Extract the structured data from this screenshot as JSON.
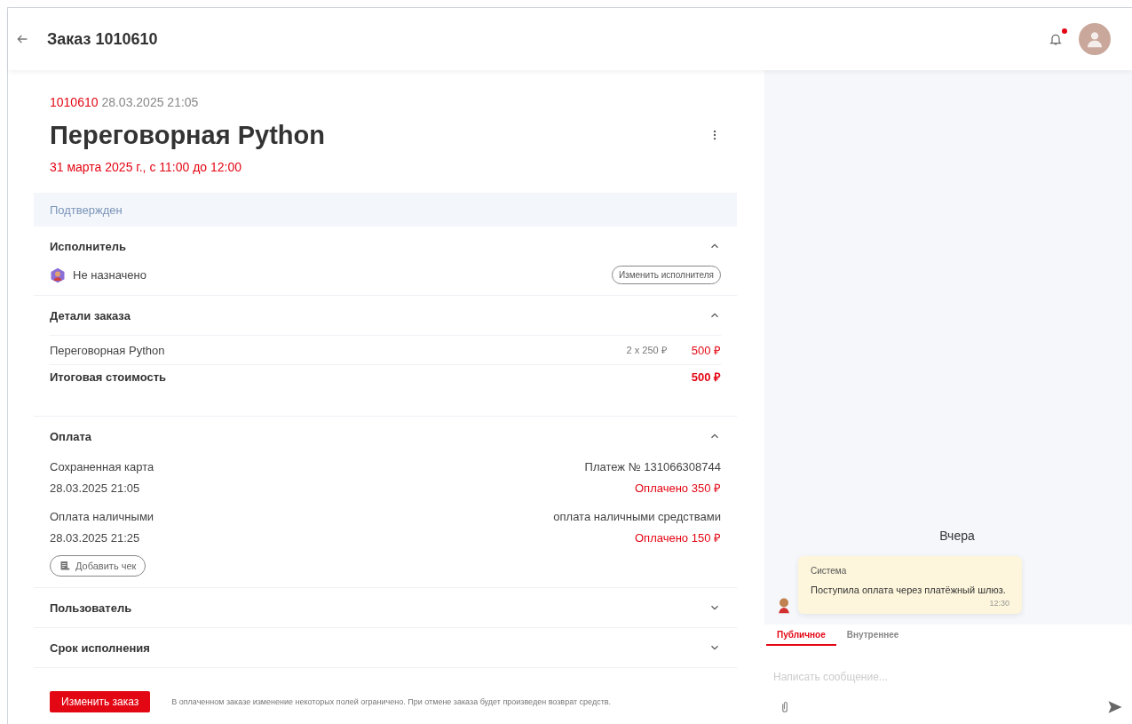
{
  "header": {
    "title": "Заказ 1010610",
    "has_notification": true
  },
  "order": {
    "number": "1010610",
    "created": "28.03.2025 21:05",
    "title": "Переговорная Python",
    "schedule": "31 марта 2025 г., с 11:00 до 12:00",
    "status": "Подтвержден"
  },
  "sections": [
    {
      "kind": "executor",
      "title": "Исполнитель",
      "expanded": true,
      "executor": "Не назначено",
      "action": "Изменить исполнителя"
    },
    {
      "kind": "details",
      "title": "Детали заказа",
      "expanded": true,
      "items": [
        {
          "name": "Переговорная Python",
          "quantity": "2 x 250 ₽",
          "price": "500 ₽"
        }
      ],
      "total_label": "Итоговая стоимость",
      "total": "500 ₽"
    },
    {
      "kind": "payment",
      "title": "Оплата",
      "expanded": true,
      "payments": [
        {
          "method": "Сохраненная карта",
          "info": "Платеж № 131066308744",
          "date": "28.03.2025 21:05",
          "amount": "Оплачено 350 ₽"
        },
        {
          "method": "Оплата наличными",
          "info": "оплата наличными средствами",
          "date": "28.03.2025 21:25",
          "amount": "Оплачено 150 ₽"
        }
      ],
      "action": "Добавить чек"
    },
    {
      "title": "Пользователь",
      "expanded": false
    },
    {
      "title": "Срок исполнения",
      "expanded": false
    }
  ],
  "footer": {
    "button": "Изменить заказ",
    "note": "В оплаченном заказе изменение некоторых полей ограничено. При отмене заказа будет произведен возврат средств."
  },
  "chat": {
    "day": "Вчера",
    "messages": [
      {
        "author": "Система",
        "text": "Поступила оплата через платёжный шлюз.",
        "time": "12:30"
      }
    ],
    "tabs": [
      {
        "label": "Публичное",
        "selected": true
      },
      {
        "label": "Внутреннее",
        "selected": false
      }
    ],
    "input": {
      "placeholder": "Написать сообщение..."
    }
  }
}
